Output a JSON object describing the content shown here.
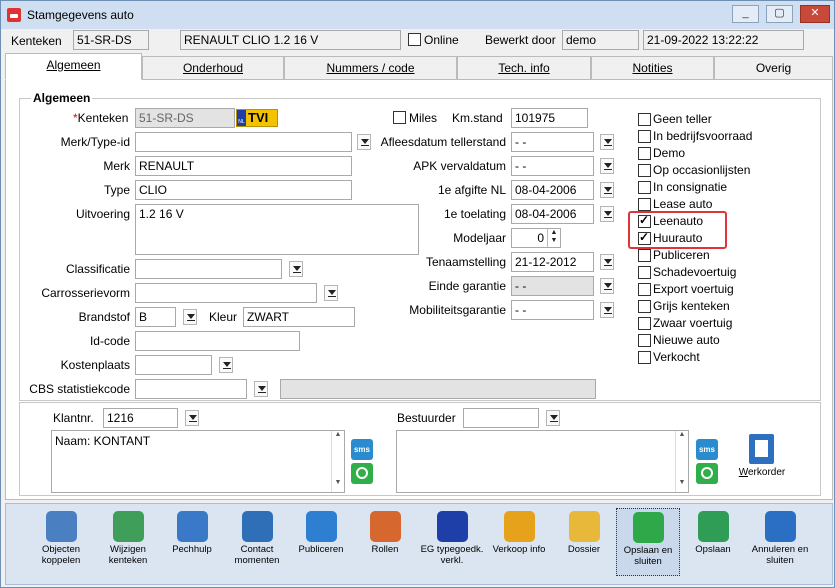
{
  "window": {
    "title": "Stamgegevens auto",
    "min": "_",
    "max": "▢",
    "close": "✕"
  },
  "header": {
    "kenteken_label": "Kenteken",
    "kenteken": "51-SR-DS",
    "model": "RENAULT CLIO 1.2 16 V",
    "online_label": "Online",
    "bewerkt_label": "Bewerkt door",
    "bewerkt": "demo",
    "datetime": "21-09-2022 13:22:22"
  },
  "tabs": [
    "Algemeen",
    "Onderhoud",
    "Nummers / code",
    "Tech. info",
    "Notities",
    "Overig"
  ],
  "group_title": "Algemeen",
  "left": {
    "kenteken_label": "Kenteken",
    "kenteken": "51-SR-DS",
    "tvi": "TVI",
    "nl": "NL",
    "merk_type_id": "Merk/Type-id",
    "merk_label": "Merk",
    "merk": "RENAULT",
    "type_label": "Type",
    "type": "CLIO",
    "uitvoering_label": "Uitvoering",
    "uitvoering": "1.2 16 V",
    "classificatie": "Classificatie",
    "carrosserievorm": "Carrosserievorm",
    "brandstof_label": "Brandstof",
    "brandstof": "B",
    "kleur_label": "Kleur",
    "kleur": "ZWART",
    "idcode": "Id-code",
    "kostenplaats": "Kostenplaats",
    "cbs": "CBS statistiekcode"
  },
  "mid": {
    "miles_label": "Miles",
    "kmstand_label": "Km.stand",
    "kmstand": "101975",
    "afleesdatum_label": "Afleesdatum tellerstand",
    "afleesdatum": "-  -",
    "apk_label": "APK vervaldatum",
    "apk": "-  -",
    "afgifte_label": "1e afgifte NL",
    "afgifte": "08-04-2006",
    "toelating_label": "1e toelating",
    "toelating": "08-04-2006",
    "modeljaar_label": "Modeljaar",
    "modeljaar": "0",
    "tenaam_label": "Tenaamstelling",
    "tenaam": "21-12-2012",
    "einde_label": "Einde garantie",
    "einde": "-  -",
    "mob_label": "Mobiliteitsgarantie",
    "mob": "-  -"
  },
  "checks": [
    {
      "label": "Geen teller",
      "checked": false
    },
    {
      "label": "In bedrijfsvoorraad",
      "checked": false
    },
    {
      "label": "Demo",
      "checked": false
    },
    {
      "label": "Op occasionlijsten",
      "checked": false
    },
    {
      "label": "In consignatie",
      "checked": false
    },
    {
      "label": "Lease auto",
      "checked": false
    },
    {
      "label": "Leenauto",
      "checked": true
    },
    {
      "label": "Huurauto",
      "checked": true
    },
    {
      "label": "Publiceren",
      "checked": false
    },
    {
      "label": "Schadevoertuig",
      "checked": false
    },
    {
      "label": "Export voertuig",
      "checked": false
    },
    {
      "label": "Grijs kenteken",
      "checked": false
    },
    {
      "label": "Zwaar voertuig",
      "checked": false
    },
    {
      "label": "Nieuwe auto",
      "checked": false
    },
    {
      "label": "Verkocht",
      "checked": false
    }
  ],
  "customer": {
    "klantnr_label": "Klantnr.",
    "klantnr": "1216",
    "naam": "Naam: KONTANT",
    "bestuurder_label": "Bestuurder",
    "sms": "sms",
    "werkorder": "Werkorder"
  },
  "toolbar": [
    {
      "label": "Objecten koppelen",
      "icon": "objects-icon",
      "color": "#4a7fc1"
    },
    {
      "label": "Wijzigen kenteken",
      "icon": "change-plate-icon",
      "color": "#3f9f5a"
    },
    {
      "label": "Pechhulp",
      "icon": "wrench-icon",
      "color": "#3a78c8"
    },
    {
      "label": "Contact momenten",
      "icon": "contact-icon",
      "color": "#2f6fb8"
    },
    {
      "label": "Publiceren",
      "icon": "cloud-icon",
      "color": "#2e7fd1"
    },
    {
      "label": "Rollen",
      "icon": "people-icon",
      "color": "#d5672f"
    },
    {
      "label": "EG typegoedk. verkl.",
      "icon": "eu-flag-icon",
      "color": "#1e3fa8"
    },
    {
      "label": "Verkoop info",
      "icon": "euro-icon",
      "color": "#e7a21c"
    },
    {
      "label": "Dossier",
      "icon": "folder-icon",
      "color": "#e8b83a"
    },
    {
      "label": "Opslaan en sluiten",
      "icon": "check-icon",
      "color": "#2fa84a"
    },
    {
      "label": "Opslaan",
      "icon": "save-icon",
      "color": "#2f9d55"
    },
    {
      "label": "Annuleren en sluiten",
      "icon": "undo-icon",
      "color": "#2a6fc4"
    }
  ]
}
